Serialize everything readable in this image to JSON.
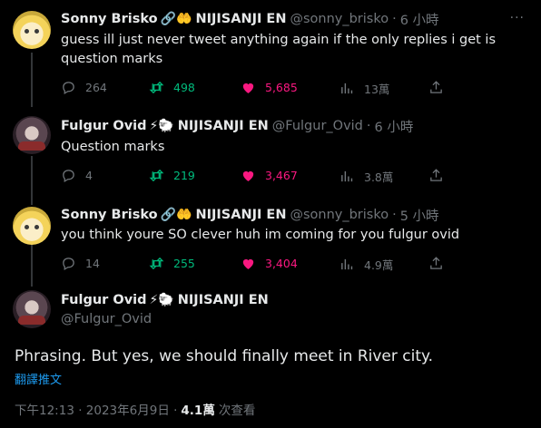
{
  "tweets": [
    {
      "name": "Sonny Brisko",
      "emojis": "🔗🤲",
      "affiliation": "NIJISANJI EN",
      "handle": "@sonny_brisko",
      "time": "6 小時",
      "text": "guess ill just never tweet anything again if the only replies i get is question marks",
      "replies": "264",
      "retweets": "498",
      "likes": "5,685",
      "views": "13萬"
    },
    {
      "name": "Fulgur Ovid",
      "emojis": "⚡🐑",
      "affiliation": "NIJISANJI EN",
      "handle": "@Fulgur_Ovid",
      "time": "6 小時",
      "text": "Question marks",
      "replies": "4",
      "retweets": "219",
      "likes": "3,467",
      "views": "3.8萬"
    },
    {
      "name": "Sonny Brisko",
      "emojis": "🔗🤲",
      "affiliation": "NIJISANJI EN",
      "handle": "@sonny_brisko",
      "time": "5 小時",
      "text": "you think youre SO clever huh im coming for you fulgur ovid",
      "replies": "14",
      "retweets": "255",
      "likes": "3,404",
      "views": "4.9萬"
    }
  ],
  "main_tweet": {
    "name": "Fulgur Ovid",
    "emojis": "⚡🐑",
    "affiliation": "NIJISANJI EN",
    "handle": "@Fulgur_Ovid",
    "text": "Phrasing. But yes, we should finally meet in River city.",
    "translate_label": "翻譯推文",
    "timestamp": "下午12:13 · 2023年6月9日 ·",
    "views_count": "4.1萬",
    "views_label": "次查看"
  },
  "ui": {
    "separator": "·",
    "more_glyph": "···"
  },
  "colors": {
    "background": "#000000",
    "text": "#e7e9ea",
    "muted": "#71767b",
    "retweet": "#00ba7c",
    "like": "#f91880",
    "link": "#1d9bf0"
  },
  "icons": [
    "reply-icon",
    "retweet-icon",
    "heart-icon",
    "views-icon",
    "share-icon",
    "more-icon"
  ]
}
